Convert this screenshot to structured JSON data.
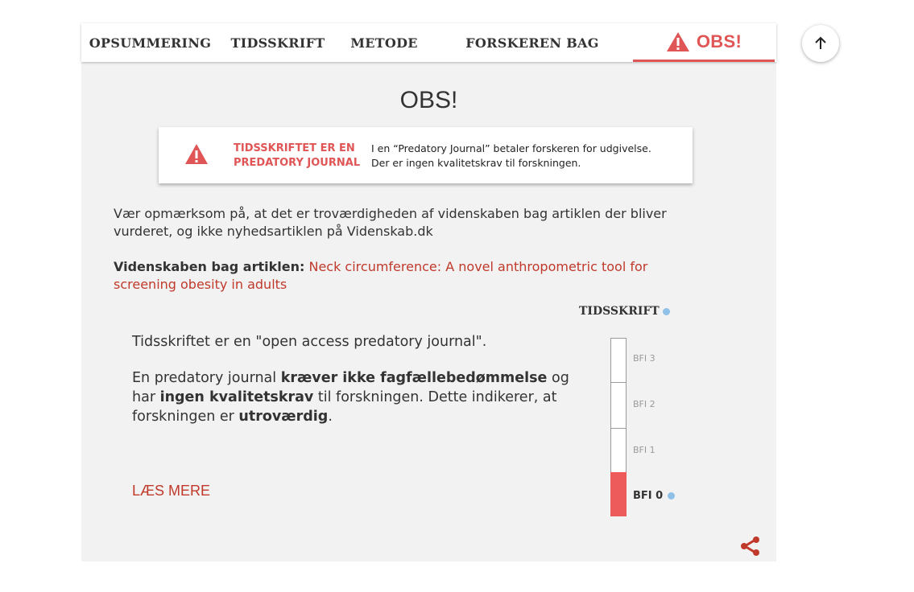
{
  "tabs": [
    {
      "label": "OPSUMMERING"
    },
    {
      "label": "TIDSSKRIFT"
    },
    {
      "label": "METODE"
    },
    {
      "label": "FORSKEREN BAG"
    },
    {
      "label": "OBS!",
      "icon": "warning-icon",
      "active": true
    }
  ],
  "page_title": "OBS!",
  "alert": {
    "icon": "warning-icon",
    "heading_line1": "TIDSSKRIFTET ER EN",
    "heading_line2": "PREDATORY JOURNAL",
    "desc_line1": "I en  “Predatory Journal” betaler forskeren for udgivelse.",
    "desc_line2": "Der er ingen kvalitetskrav til forskningen."
  },
  "intro": "Vær opmærksom på, at det er troværdigheden af videnskaben bag artiklen der bliver vurderet, og ikke nyhedsartiklen på Videnskab.dk",
  "science": {
    "label": "Videnskaben bag artiklen:",
    "link": "Neck circumference: A novel anthropometric tool for screening obesity in adults"
  },
  "journal_meter": {
    "title": "TIDSSKRIFT",
    "levels": [
      "BFI 3",
      "BFI 2",
      "BFI 1",
      "BFI 0"
    ],
    "current": "BFI 0",
    "fill_color": "#ee5b5b"
  },
  "body": {
    "p1": "Tidsskriftet er en \"open access predatory journal\".",
    "p2_a": "En predatory journal ",
    "p2_b": "kræver ikke fagfællebedømmelse",
    "p2_c": " og har ",
    "p2_d": "ingen kvalitetskrav",
    "p2_e": " til forskningen. Dette indikerer, at forskningen er ",
    "p2_f": "utroværdig",
    "p2_g": "."
  },
  "read_more": "LÆS MERE",
  "icons": {
    "share": "share-icon",
    "scroll_top": "arrow-up-icon"
  },
  "colors": {
    "accent": "#e05555",
    "link": "#c0392b"
  }
}
